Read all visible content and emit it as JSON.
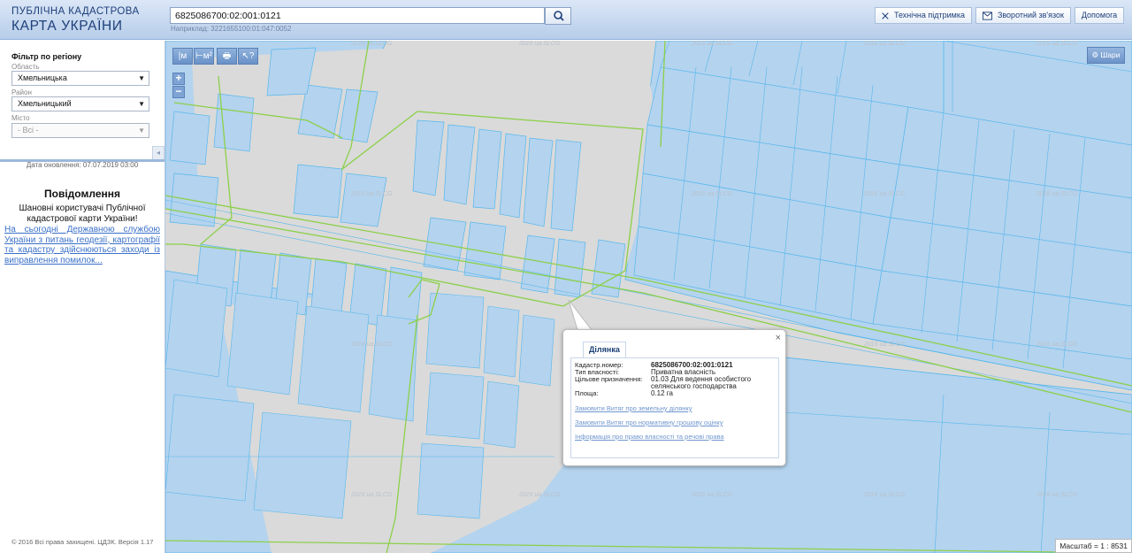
{
  "header": {
    "logo_line1": "ПУБЛІЧНА КАДАСТРОВА",
    "logo_line2": "КАРТА УКРАЇНИ",
    "search_value": "6825086700:02:001:0121",
    "search_hint": "Наприклад: 3221655100:01:047:0052",
    "support_label": "Технічна підтримка",
    "feedback_label": "Зворотний зв'язок",
    "help_label": "Допомога"
  },
  "sidebar": {
    "filter_title": "Фільтр по регіону",
    "oblast_label": "Область",
    "oblast_value": "Хмельницька",
    "rayon_label": "Район",
    "rayon_value": "Хмельницький",
    "city_label": "Місто",
    "city_value": "- Всі -",
    "update_date": "Дата оновлення: 07.07.2019 03:00",
    "notice_title": "Повідомлення",
    "notice_body": "Шановні користувачі Публічної кадастрової карти України!",
    "notice_link": "На сьогодні Державною службою України з питань геодезії, картографії та кадастру здійснюються заходи із виправлення помилок...",
    "copyright": "© 2016 Всі права захищені. ЦДЗК. Версія 1.17"
  },
  "map": {
    "tools": [
      "|м",
      "⊢м²",
      "🖶",
      "↖?"
    ],
    "zoom_in": "+",
    "zoom_out": "−",
    "balls_label": "Шари",
    "watermark": "2016 ua.SLCG",
    "scale_text": "Масштаб = 1 : 8531"
  },
  "popup": {
    "tab_label": "Ділянка",
    "close": "×",
    "rows": [
      {
        "key": "Кадастр.номер:",
        "value": "6825086700:02:001:0121"
      },
      {
        "key": "Тип власності:",
        "value": "Приватна власність"
      },
      {
        "key": "Цільове призначення:",
        "value": "01.03 Для ведення особистого селянського господарства"
      },
      {
        "key": "Площа:",
        "value": "0.12 га"
      }
    ],
    "links": [
      "Замовити Витяг про земельну ділянку",
      "Замовити Витяг про нормативну грошову оцінку",
      "Інформація про право власності та речові права"
    ]
  },
  "colors": {
    "parcel_fill": "#b4d3ee",
    "parcel_stroke": "#57b7ec",
    "boundary": "#8cd04a",
    "map_bg": "#dadada"
  }
}
